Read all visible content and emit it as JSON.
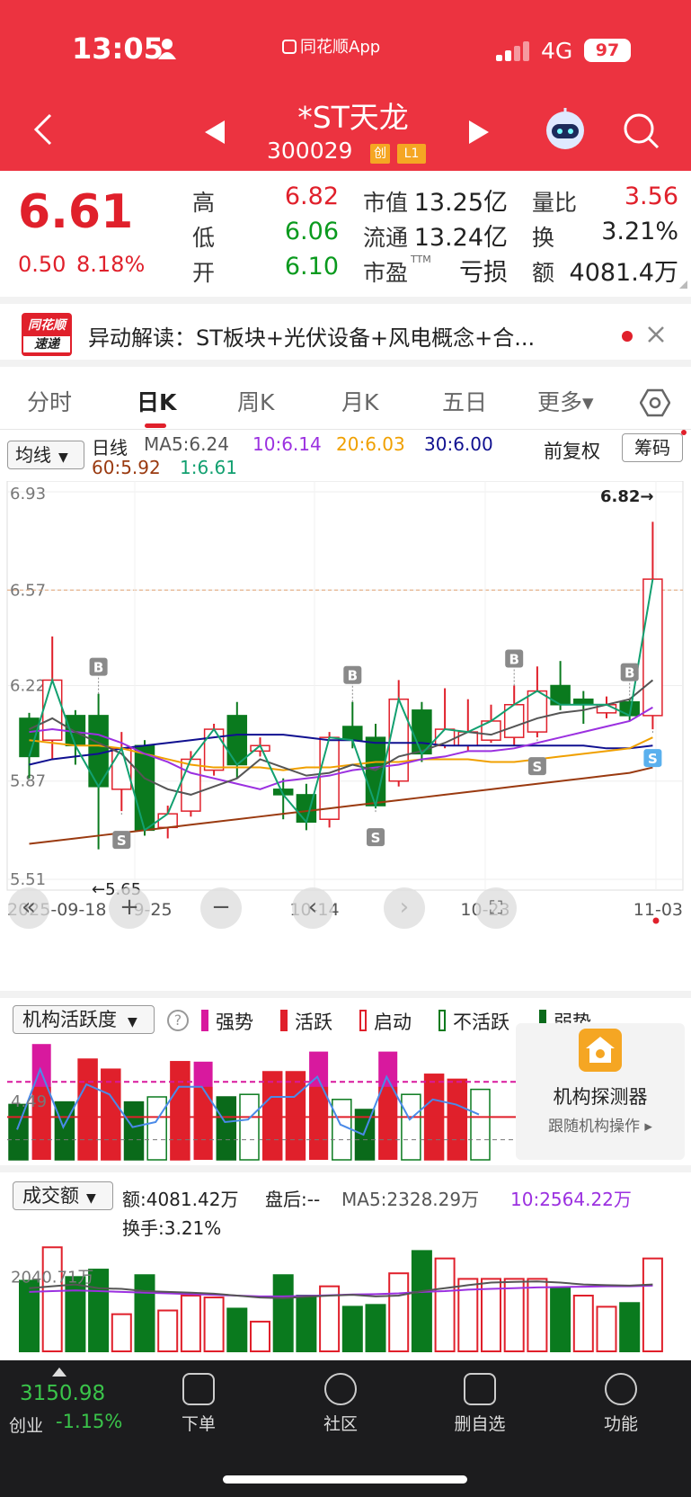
{
  "status_bar": {
    "time": "13:05",
    "app_badge": "同花顺App",
    "network": "4G",
    "battery": "97"
  },
  "header": {
    "stock_name": "*ST天龙",
    "stock_code": "300029",
    "badge_chuang": "创",
    "badge_level": "L1"
  },
  "quote": {
    "price": "6.61",
    "change": "0.50",
    "change_pct": "8.18%",
    "high_label": "高",
    "high": "6.82",
    "low_label": "低",
    "low": "6.06",
    "open_label": "开",
    "open": "6.10",
    "mcap_label": "市值",
    "mcap": "13.25亿",
    "float_label": "流通",
    "float": "13.24亿",
    "pe_label": "市盈",
    "pe_sup": "TTM",
    "pe": "亏损",
    "vr_label": "量比",
    "vr": "3.56",
    "turnover_label": "换",
    "turnover": "3.21%",
    "amount_label": "额",
    "amount": "4081.4万"
  },
  "news": {
    "logo_top": "同花顺",
    "logo_bottom": "速递",
    "text": "异动解读：ST板块+光伏设备+风电概念+合..."
  },
  "tabs": [
    "分时",
    "日K",
    "周K",
    "月K",
    "五日",
    "更多▾"
  ],
  "ma_legend": {
    "selector": "均线",
    "line_type": "日线",
    "ma5": "MA5:6.24",
    "ma10": "10:6.14",
    "ma20": "20:6.03",
    "ma30": "30:6.00",
    "ma60": "60:5.92",
    "ma1": "1:6.61",
    "fq": "前复权",
    "chip": "筹码"
  },
  "colors": {
    "up": "#e0202b",
    "down": "#0a7a1e",
    "ma5": "#555555",
    "ma10": "#9b30e0",
    "ma20": "#f0a000",
    "ma30": "#101090",
    "ma60": "#9a3a10",
    "ma1": "#12a070"
  },
  "chart_data": {
    "type": "candlestick",
    "y_ticks": [
      "6.93",
      "6.57",
      "6.22",
      "5.87",
      "5.51"
    ],
    "x_ticks": [
      "2025-09-18",
      "9-25",
      "10-14",
      "10-23",
      "11-03"
    ],
    "high_marker": "6.82→",
    "low_marker": "←5.65",
    "candles": [
      {
        "o": 6.1,
        "c": 5.96,
        "h": 6.12,
        "l": 5.88
      },
      {
        "o": 6.02,
        "c": 6.24,
        "h": 6.4,
        "l": 5.95
      },
      {
        "o": 6.11,
        "c": 6.0,
        "h": 6.13,
        "l": 5.93
      },
      {
        "o": 6.11,
        "c": 5.85,
        "h": 6.19,
        "l": 5.62
      },
      {
        "o": 5.84,
        "c": 5.99,
        "h": 6.05,
        "l": 5.76
      },
      {
        "o": 6.0,
        "c": 5.69,
        "h": 6.02,
        "l": 5.67
      },
      {
        "o": 5.7,
        "c": 5.75,
        "h": 5.78,
        "l": 5.66
      },
      {
        "o": 5.76,
        "c": 5.95,
        "h": 5.98,
        "l": 5.74
      },
      {
        "o": 5.91,
        "c": 6.06,
        "h": 6.08,
        "l": 5.89
      },
      {
        "o": 6.11,
        "c": 5.93,
        "h": 6.16,
        "l": 5.88
      },
      {
        "o": 5.98,
        "c": 6.0,
        "h": 6.03,
        "l": 5.96
      },
      {
        "o": 5.84,
        "c": 5.82,
        "h": 5.88,
        "l": 5.73
      },
      {
        "o": 5.82,
        "c": 5.72,
        "h": 5.86,
        "l": 5.69
      },
      {
        "o": 5.73,
        "c": 6.03,
        "h": 6.05,
        "l": 5.7
      },
      {
        "o": 6.07,
        "c": 6.02,
        "h": 6.16,
        "l": 5.99
      },
      {
        "o": 6.03,
        "c": 5.78,
        "h": 6.08,
        "l": 5.77
      },
      {
        "o": 5.87,
        "c": 6.17,
        "h": 6.24,
        "l": 5.85
      },
      {
        "o": 6.13,
        "c": 5.97,
        "h": 6.16,
        "l": 5.94
      },
      {
        "o": 6.0,
        "c": 6.06,
        "h": 6.21,
        "l": 5.99
      },
      {
        "o": 6.0,
        "c": 6.05,
        "h": 6.17,
        "l": 5.98
      },
      {
        "o": 6.02,
        "c": 6.09,
        "h": 6.15,
        "l": 6.01
      },
      {
        "o": 6.03,
        "c": 6.15,
        "h": 6.22,
        "l": 6.0
      },
      {
        "o": 6.05,
        "c": 6.2,
        "h": 6.29,
        "l": 6.03
      },
      {
        "o": 6.22,
        "c": 6.15,
        "h": 6.31,
        "l": 6.13
      },
      {
        "o": 6.17,
        "c": 6.15,
        "h": 6.2,
        "l": 6.08
      },
      {
        "o": 6.12,
        "c": 6.15,
        "h": 6.18,
        "l": 6.1
      },
      {
        "o": 6.16,
        "c": 6.11,
        "h": 6.17,
        "l": 6.09
      },
      {
        "o": 6.11,
        "c": 6.61,
        "h": 6.82,
        "l": 6.06
      }
    ],
    "ma5": [
      6.06,
      6.1,
      6.05,
      6.01,
      5.97,
      5.88,
      5.84,
      5.82,
      5.85,
      5.88,
      5.95,
      5.92,
      5.89,
      5.9,
      5.93,
      5.91,
      5.96,
      5.98,
      6.01,
      6.05,
      6.04,
      6.07,
      6.1,
      6.12,
      6.13,
      6.15,
      6.17,
      6.24
    ],
    "ma10": [
      6.05,
      6.06,
      6.05,
      6.04,
      6.01,
      5.97,
      5.94,
      5.9,
      5.88,
      5.86,
      5.84,
      5.87,
      5.88,
      5.89,
      5.91,
      5.92,
      5.93,
      5.95,
      5.96,
      5.98,
      5.98,
      5.99,
      6.01,
      6.03,
      6.05,
      6.07,
      6.09,
      6.14
    ],
    "ma20": [
      6.02,
      6.01,
      6.0,
      6.0,
      5.99,
      5.97,
      5.95,
      5.93,
      5.92,
      5.92,
      5.92,
      5.91,
      5.92,
      5.92,
      5.93,
      5.94,
      5.94,
      5.95,
      5.95,
      5.95,
      5.94,
      5.94,
      5.95,
      5.96,
      5.97,
      5.98,
      5.99,
      6.03
    ],
    "ma30": [
      5.93,
      5.95,
      5.96,
      5.97,
      5.99,
      6.0,
      6.01,
      6.02,
      6.03,
      6.04,
      6.04,
      6.04,
      6.03,
      6.02,
      6.02,
      6.01,
      6.01,
      6.01,
      6.0,
      6.0,
      6.0,
      6.0,
      6.0,
      6.0,
      6.0,
      5.99,
      5.99,
      6.0
    ],
    "ma60": [
      5.64,
      5.65,
      5.66,
      5.67,
      5.68,
      5.69,
      5.7,
      5.71,
      5.72,
      5.73,
      5.74,
      5.75,
      5.76,
      5.77,
      5.78,
      5.79,
      5.8,
      5.81,
      5.82,
      5.83,
      5.84,
      5.85,
      5.86,
      5.87,
      5.88,
      5.89,
      5.9,
      5.92
    ],
    "markers": [
      {
        "i": 3,
        "t": "B"
      },
      {
        "i": 4,
        "t": "S"
      },
      {
        "i": 14,
        "t": "B"
      },
      {
        "i": 15,
        "t": "S"
      },
      {
        "i": 21,
        "t": "B"
      },
      {
        "i": 22,
        "t": "S"
      },
      {
        "i": 26,
        "t": "B"
      },
      {
        "i": 27,
        "t": "S"
      }
    ],
    "activity": {
      "levels": [
        "weak",
        "strong",
        "weak",
        "active",
        "active",
        "weak",
        "inactive",
        "active",
        "strong",
        "weak",
        "inactive",
        "active",
        "active",
        "strong",
        "inactive",
        "weak",
        "strong",
        "inactive",
        "active",
        "active",
        "inactive"
      ],
      "values": [
        2.2,
        4.6,
        2.3,
        4.0,
        3.6,
        2.3,
        2.5,
        3.9,
        3.9,
        2.5,
        2.6,
        3.5,
        3.5,
        4.3,
        2.4,
        2.0,
        4.3,
        2.6,
        3.4,
        3.2,
        2.8
      ],
      "ref_level": "4.49"
    },
    "volume": {
      "up": [
        false,
        true,
        false,
        false,
        true,
        false,
        true,
        true,
        true,
        false,
        true,
        false,
        false,
        true,
        false,
        false,
        true,
        false,
        true,
        true,
        true,
        true,
        true,
        false,
        true,
        true,
        false,
        true
      ],
      "values": [
        1900,
        2800,
        2000,
        2200,
        1000,
        2050,
        1100,
        1500,
        1450,
        1150,
        800,
        2050,
        1500,
        1750,
        1200,
        1250,
        2100,
        2700,
        2500,
        1950,
        1950,
        1950,
        1950,
        1700,
        1500,
        1200,
        1300,
        2500
      ],
      "ma": [
        1700,
        1750,
        1800,
        1700,
        1680,
        1620,
        1600,
        1580,
        1550,
        1500,
        1450,
        1430,
        1470,
        1500,
        1520,
        1480,
        1500,
        1620,
        1700,
        1780,
        1850,
        1870,
        1880,
        1850,
        1800,
        1780,
        1770,
        1800
      ],
      "ma10": [
        1600,
        1620,
        1640,
        1620,
        1600,
        1580,
        1560,
        1540,
        1520,
        1500,
        1480,
        1480,
        1490,
        1510,
        1530,
        1540,
        1560,
        1600,
        1620,
        1660,
        1680,
        1700,
        1720,
        1730,
        1740,
        1750,
        1750,
        1770
      ]
    }
  },
  "activity_panel": {
    "selector": "机构活跃度",
    "strong": "强势",
    "active": "活跃",
    "start": "启动",
    "inactive": "不活跃",
    "weak": "弱势",
    "tick": "4.49",
    "detector_title": "机构探测器",
    "detector_sub": "跟随机构操作 ▸"
  },
  "volume_panel": {
    "selector": "成交额",
    "amount": "额:4081.42万",
    "after": "盘后:--",
    "ma5": "MA5:2328.29万",
    "ma10": "10:2564.22万",
    "turnover": "换手:3.21%",
    "tick": "2040.71万"
  },
  "bottom_bar": {
    "index_value": "3150.98",
    "index_name": "创业",
    "index_change": "-1.15%",
    "items": [
      "下单",
      "社区",
      "删自选",
      "功能"
    ]
  }
}
